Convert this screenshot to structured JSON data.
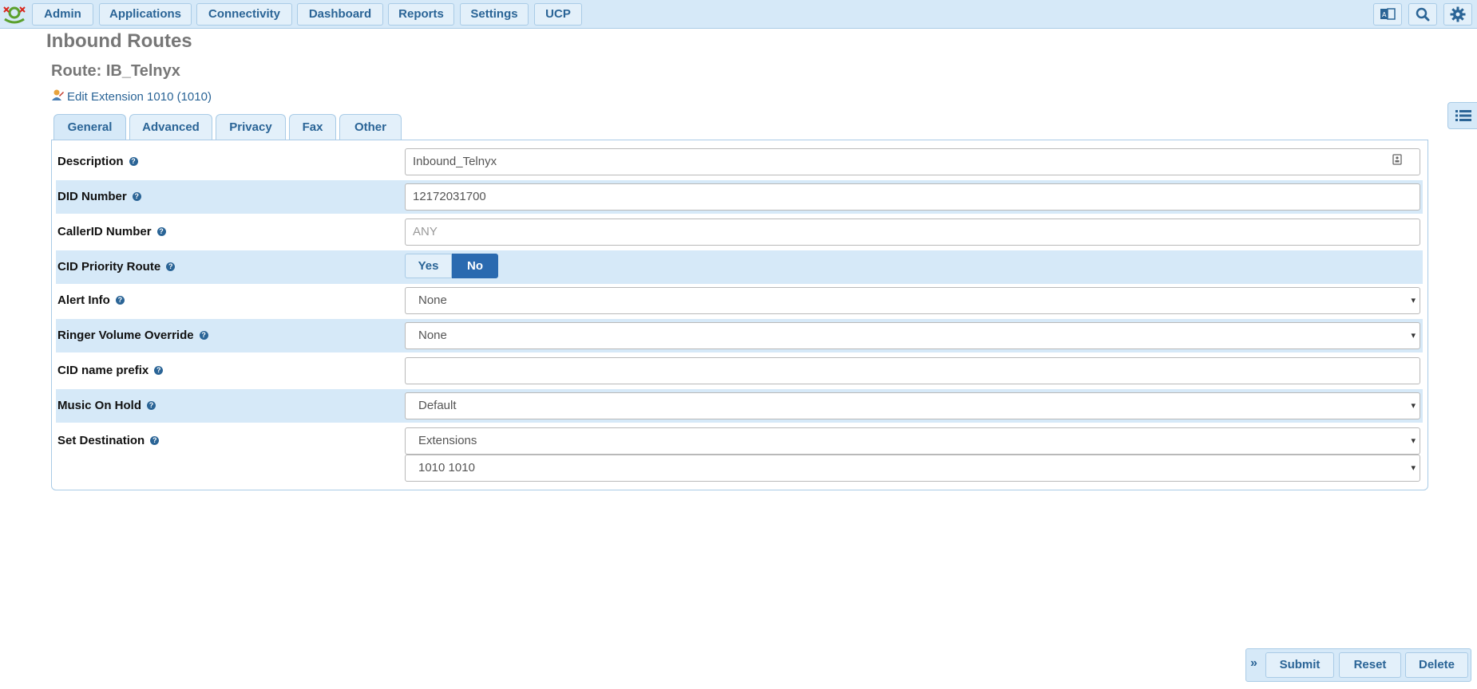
{
  "nav": {
    "items": [
      {
        "label": "Admin"
      },
      {
        "label": "Applications"
      },
      {
        "label": "Connectivity"
      },
      {
        "label": "Dashboard"
      },
      {
        "label": "Reports"
      },
      {
        "label": "Settings"
      },
      {
        "label": "UCP"
      }
    ],
    "right_icons": [
      "language-icon",
      "search-icon",
      "gear-icon"
    ]
  },
  "page": {
    "module_title": "Inbound Routes",
    "route_title": "Route: IB_Telnyx",
    "edit_link": "Edit Extension 1010 (1010)"
  },
  "tabs": [
    {
      "label": "General",
      "active": true
    },
    {
      "label": "Advanced"
    },
    {
      "label": "Privacy"
    },
    {
      "label": "Fax"
    },
    {
      "label": "Other"
    }
  ],
  "form": {
    "description": {
      "label": "Description",
      "value": "Inbound_Telnyx"
    },
    "did_number": {
      "label": "DID Number",
      "value": "12172031700"
    },
    "callerid_number": {
      "label": "CallerID Number",
      "value": "",
      "placeholder": "ANY"
    },
    "cid_priority_route": {
      "label": "CID Priority Route",
      "options": [
        "Yes",
        "No"
      ],
      "selected": "No"
    },
    "alert_info": {
      "label": "Alert Info",
      "value": "None"
    },
    "ringer_volume_override": {
      "label": "Ringer Volume Override",
      "value": "None"
    },
    "cid_name_prefix": {
      "label": "CID name prefix",
      "value": ""
    },
    "music_on_hold": {
      "label": "Music On Hold",
      "value": "Default"
    },
    "set_destination": {
      "label": "Set Destination",
      "type_value": "Extensions",
      "target_value": "1010 1010"
    }
  },
  "footer": {
    "submit": "Submit",
    "reset": "Reset",
    "delete": "Delete"
  },
  "colors": {
    "nav_bg": "#d6e9f8",
    "link": "#2a6496",
    "selected_segment": "#2a6ab0"
  }
}
